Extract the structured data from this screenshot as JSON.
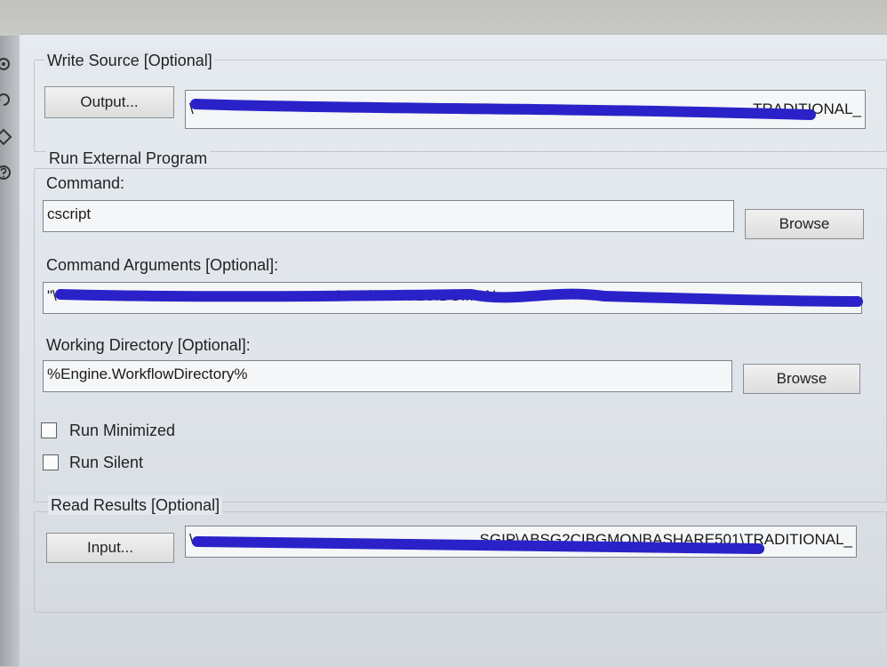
{
  "write_source": {
    "legend": "Write Source [Optional]",
    "output_button": "Output...",
    "path_visible": "\\",
    "path_tail": "TRADITIONAL_"
  },
  "run_external_program": {
    "legend": "Run External Program",
    "command_label": "Command:",
    "command_value": "cscript",
    "command_browse": "Browse",
    "arguments_label": "Command Arguments [Optional]:",
    "arguments_visible": "\"\\",
    "arguments_fragment": "SGIP\\ABSG2CIBGMON",
    "working_dir_label": "Working Directory [Optional]:",
    "working_dir_value": "%Engine.WorkflowDirectory%",
    "working_dir_browse": "Browse",
    "run_minimized_label": "Run Minimized",
    "run_silent_label": "Run Silent"
  },
  "read_results": {
    "legend": "Read Results [Optional]",
    "input_button": "Input...",
    "path_visible": "\\",
    "path_fragment": "SGIP\\ABSG2CIBGMONBASHARE501\\TRADITIONAL_"
  },
  "colors": {
    "panel": "#e3e8ee",
    "redaction": "#2a22c8"
  },
  "side_icons": [
    "gear-icon",
    "rotate-icon",
    "tag-icon",
    "help-icon"
  ]
}
